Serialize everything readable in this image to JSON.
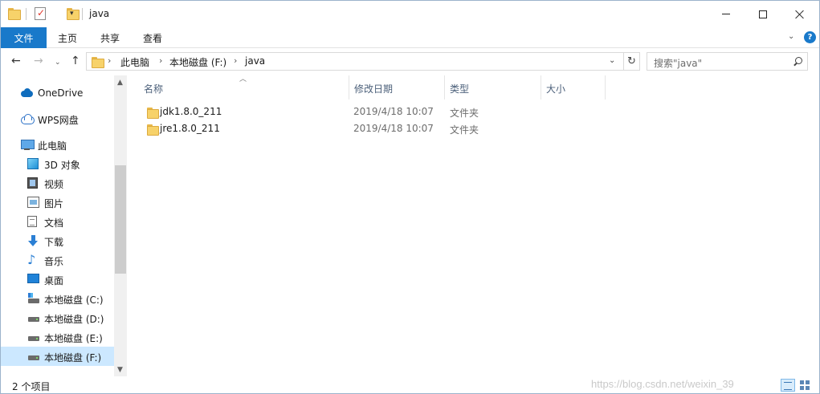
{
  "window": {
    "title": "java"
  },
  "ribbon": {
    "tabs": [
      "文件",
      "主页",
      "共享",
      "查看"
    ],
    "help": "?"
  },
  "address": {
    "crumbs": [
      "此电脑",
      "本地磁盘 (F:)",
      "java"
    ]
  },
  "search": {
    "placeholder": "搜索\"java\""
  },
  "navpane": {
    "items": [
      {
        "label": "OneDrive",
        "icon": "cloud-icon"
      },
      {
        "label": "WPS网盘",
        "icon": "wps-cloud-icon"
      },
      {
        "label": "此电脑",
        "icon": "computer-icon"
      },
      {
        "label": "3D 对象",
        "icon": "3d-objects-icon"
      },
      {
        "label": "视频",
        "icon": "video-icon"
      },
      {
        "label": "图片",
        "icon": "picture-icon"
      },
      {
        "label": "文档",
        "icon": "document-icon"
      },
      {
        "label": "下载",
        "icon": "download-icon"
      },
      {
        "label": "音乐",
        "icon": "music-icon"
      },
      {
        "label": "桌面",
        "icon": "desktop-icon"
      },
      {
        "label": "本地磁盘 (C:)",
        "icon": "system-drive-icon"
      },
      {
        "label": "本地磁盘 (D:)",
        "icon": "drive-icon"
      },
      {
        "label": "本地磁盘 (E:)",
        "icon": "drive-icon"
      },
      {
        "label": "本地磁盘 (F:)",
        "icon": "drive-icon",
        "selected": true
      }
    ]
  },
  "filelist": {
    "columns": [
      "名称",
      "修改日期",
      "类型",
      "大小"
    ],
    "rows": [
      {
        "name": "jdk1.8.0_211",
        "date": "2019/4/18 10:07",
        "type": "文件夹",
        "size": ""
      },
      {
        "name": "jre1.8.0_211",
        "date": "2019/4/18 10:07",
        "type": "文件夹",
        "size": ""
      }
    ]
  },
  "status": {
    "text": "2 个项目",
    "watermark": "https://blog.csdn.net/weixin_39"
  },
  "colors": {
    "accent": "#1979ca",
    "selection": "#cce8ff",
    "folder": "#f7d26a"
  }
}
